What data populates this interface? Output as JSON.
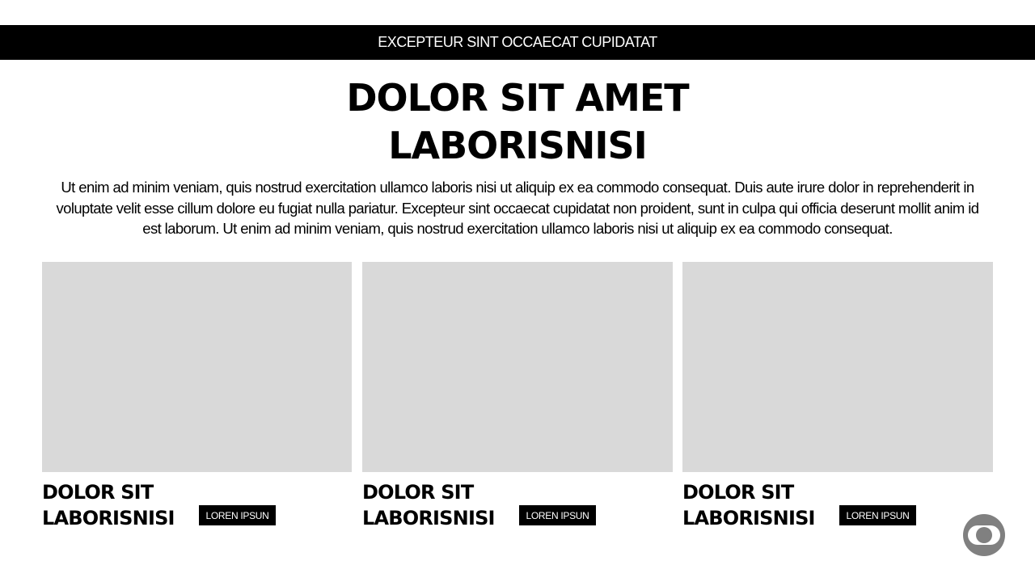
{
  "banner": {
    "text": "EXCEPTEUR SINT OCCAECAT CUPIDATAT"
  },
  "hero": {
    "title_line1": "DOLOR SIT AMET",
    "title_line2": "LABORISNISI",
    "body": "Ut enim ad minim veniam, quis nostrud exercitation ullamco laboris nisi ut aliquip ex ea commodo consequat. Duis aute irure dolor in reprehenderit in voluptate velit esse cillum dolore eu fugiat nulla pariatur. Excepteur sint occaecat cupidatat non proident, sunt in culpa qui officia deserunt mollit anim id est laborum. Ut enim ad minim veniam, quis nostrud exercitation ullamco laboris nisi ut aliquip ex ea commodo consequat."
  },
  "cards": [
    {
      "title_line1": "DOLOR SIT",
      "title_line2": "LABORISNISI",
      "button_label": "LOREN IPSUN"
    },
    {
      "title_line1": "DOLOR SIT",
      "title_line2": "LABORISNISI",
      "button_label": "LOREN IPSUN"
    },
    {
      "title_line1": "DOLOR SIT",
      "title_line2": "LABORISNISI",
      "button_label": "LOREN IPSUN"
    }
  ],
  "logo": {
    "icon": "brand-logo-icon"
  },
  "colors": {
    "bar": "#000000",
    "placeholder": "#d9d9d9",
    "logo": "#808080"
  }
}
